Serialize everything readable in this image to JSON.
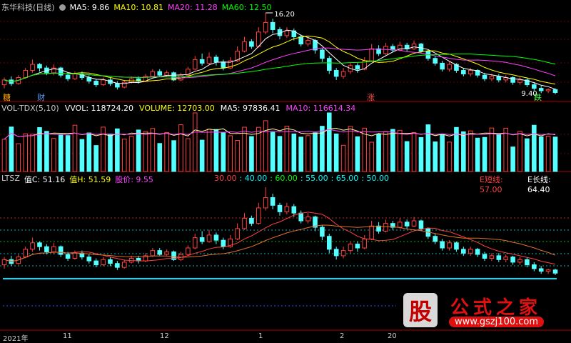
{
  "main_panel": {
    "stock_name": "东华科技(日线)",
    "ma": [
      {
        "label": "MA5: 9.86",
        "color": "#ffffff"
      },
      {
        "label": "MA10: 10.81",
        "color": "#ffff00"
      },
      {
        "label": "MA20: 11.28",
        "color": "#ff40ff"
      },
      {
        "label": "MA60: 12.50",
        "color": "#00ff00"
      }
    ],
    "annotations": {
      "high": "16.20",
      "low": "9.40"
    },
    "markers": [
      {
        "text": "糖",
        "color": "#ffa500"
      },
      {
        "text": "财",
        "color": "#5a9cff"
      },
      {
        "text": "涨",
        "color": "#ff5050"
      },
      {
        "text": "跌",
        "color": "#40ff40"
      }
    ]
  },
  "volume_panel": {
    "items": [
      {
        "label": "VOL-TDX(5,10)",
        "color": "#cccccc"
      },
      {
        "label": "VVOL: 118724.20",
        "color": "#ffffff"
      },
      {
        "label": "VOLUME: 12703.00",
        "color": "#ffff00"
      },
      {
        "label": "MA5: 97836.41",
        "color": "#ffffff"
      },
      {
        "label": "MA10: 116614.34",
        "color": "#ff40ff"
      }
    ]
  },
  "ltsz_panel": {
    "items": [
      {
        "label": "LTSZ",
        "color": "#cccccc"
      },
      {
        "label": "值C: 51.16",
        "color": "#ffffff"
      },
      {
        "label": "值H: 51.59",
        "color": "#ffff00"
      },
      {
        "label": "股价: 9.55",
        "color": "#ff40ff"
      }
    ],
    "levels": [
      {
        "label": "30.00",
        "color": "#ff4040"
      },
      {
        "label": ": 40.00",
        "color": "#00ffff"
      },
      {
        "label": ": 60.00",
        "color": "#00ff00"
      },
      {
        "label": ": 55.00",
        "color": "#00ffff"
      },
      {
        "label": ": 65.00",
        "color": "#00ffff"
      },
      {
        "label": ": 50.00",
        "color": "#00ffff"
      }
    ],
    "right_labels": [
      {
        "label": "E短线: 57.00",
        "color": "#ff4040"
      },
      {
        "label": "E长线: 64.40",
        "color": "#ffffff"
      }
    ]
  },
  "x_axis": [
    "2021年",
    "11",
    "12",
    "1",
    "2",
    "20"
  ],
  "logo": {
    "glyph": "股",
    "text": "公式之家",
    "url": "www.gszj100.com"
  },
  "chart_data": {
    "type": "candlestick",
    "panels": [
      "price",
      "volume",
      "ltsz"
    ],
    "price_range": [
      9.4,
      16.2
    ],
    "series_shape": [
      {
        "o": 10.2,
        "c": 10.6,
        "h": 10.8,
        "l": 9.9
      },
      {
        "o": 10.6,
        "c": 10.3,
        "h": 10.9,
        "l": 10.1
      },
      {
        "o": 10.3,
        "c": 10.8,
        "h": 11.0,
        "l": 10.2
      },
      {
        "o": 10.8,
        "c": 11.4,
        "h": 11.6,
        "l": 10.7
      },
      {
        "o": 11.4,
        "c": 11.9,
        "h": 12.3,
        "l": 11.2
      },
      {
        "o": 11.9,
        "c": 11.6,
        "h": 12.0,
        "l": 11.3
      },
      {
        "o": 11.6,
        "c": 11.2,
        "h": 11.8,
        "l": 11.0
      },
      {
        "o": 11.2,
        "c": 11.6,
        "h": 11.9,
        "l": 11.0
      },
      {
        "o": 11.6,
        "c": 11.0,
        "h": 11.7,
        "l": 10.8
      },
      {
        "o": 11.0,
        "c": 10.7,
        "h": 11.2,
        "l": 10.5
      },
      {
        "o": 10.7,
        "c": 11.1,
        "h": 11.3,
        "l": 10.6
      },
      {
        "o": 11.1,
        "c": 10.8,
        "h": 11.3,
        "l": 10.6
      },
      {
        "o": 10.8,
        "c": 10.5,
        "h": 11.0,
        "l": 10.3
      },
      {
        "o": 10.5,
        "c": 10.2,
        "h": 10.7,
        "l": 10.0
      },
      {
        "o": 10.2,
        "c": 10.6,
        "h": 10.8,
        "l": 10.1
      },
      {
        "o": 10.6,
        "c": 10.3,
        "h": 10.8,
        "l": 10.1
      },
      {
        "o": 10.3,
        "c": 10.0,
        "h": 10.5,
        "l": 9.8
      },
      {
        "o": 10.0,
        "c": 10.4,
        "h": 10.6,
        "l": 9.9
      },
      {
        "o": 10.4,
        "c": 10.7,
        "h": 10.9,
        "l": 10.3
      },
      {
        "o": 10.7,
        "c": 10.5,
        "h": 10.9,
        "l": 10.3
      },
      {
        "o": 10.5,
        "c": 10.9,
        "h": 11.1,
        "l": 10.4
      },
      {
        "o": 10.9,
        "c": 11.3,
        "h": 11.5,
        "l": 10.8
      },
      {
        "o": 11.3,
        "c": 11.0,
        "h": 11.5,
        "l": 10.9
      },
      {
        "o": 11.0,
        "c": 11.2,
        "h": 11.4,
        "l": 10.9
      },
      {
        "o": 11.2,
        "c": 10.6,
        "h": 11.3,
        "l": 10.5
      },
      {
        "o": 10.6,
        "c": 11.0,
        "h": 11.2,
        "l": 10.5
      },
      {
        "o": 11.0,
        "c": 11.5,
        "h": 11.7,
        "l": 10.9
      },
      {
        "o": 11.5,
        "c": 12.3,
        "h": 12.6,
        "l": 11.4
      },
      {
        "o": 12.3,
        "c": 12.0,
        "h": 12.8,
        "l": 11.8
      },
      {
        "o": 12.0,
        "c": 12.5,
        "h": 12.9,
        "l": 11.9
      },
      {
        "o": 12.5,
        "c": 12.1,
        "h": 12.7,
        "l": 11.8
      },
      {
        "o": 12.1,
        "c": 11.6,
        "h": 12.3,
        "l": 11.4
      },
      {
        "o": 11.6,
        "c": 12.2,
        "h": 12.5,
        "l": 11.5
      },
      {
        "o": 12.2,
        "c": 13.0,
        "h": 13.4,
        "l": 12.1
      },
      {
        "o": 13.0,
        "c": 13.8,
        "h": 14.2,
        "l": 12.9
      },
      {
        "o": 13.8,
        "c": 13.4,
        "h": 14.0,
        "l": 13.2
      },
      {
        "o": 13.4,
        "c": 14.6,
        "h": 15.0,
        "l": 13.3
      },
      {
        "o": 14.6,
        "c": 15.4,
        "h": 16.2,
        "l": 14.4
      },
      {
        "o": 15.4,
        "c": 14.8,
        "h": 15.7,
        "l": 14.5
      },
      {
        "o": 14.8,
        "c": 14.3,
        "h": 15.0,
        "l": 14.0
      },
      {
        "o": 14.3,
        "c": 14.7,
        "h": 15.0,
        "l": 14.1
      },
      {
        "o": 14.7,
        "c": 14.2,
        "h": 14.9,
        "l": 13.9
      },
      {
        "o": 14.2,
        "c": 13.6,
        "h": 14.4,
        "l": 13.4
      },
      {
        "o": 13.6,
        "c": 13.9,
        "h": 14.2,
        "l": 13.4
      },
      {
        "o": 13.9,
        "c": 13.1,
        "h": 14.0,
        "l": 12.8
      },
      {
        "o": 13.1,
        "c": 12.4,
        "h": 13.3,
        "l": 12.1
      },
      {
        "o": 12.4,
        "c": 11.4,
        "h": 12.6,
        "l": 11.1
      },
      {
        "o": 11.4,
        "c": 10.9,
        "h": 11.6,
        "l": 10.6
      },
      {
        "o": 10.9,
        "c": 11.3,
        "h": 11.6,
        "l": 10.7
      },
      {
        "o": 11.3,
        "c": 11.8,
        "h": 12.0,
        "l": 11.1
      },
      {
        "o": 11.8,
        "c": 11.5,
        "h": 12.0,
        "l": 11.2
      },
      {
        "o": 11.5,
        "c": 12.2,
        "h": 12.5,
        "l": 11.4
      },
      {
        "o": 12.2,
        "c": 13.2,
        "h": 13.6,
        "l": 12.1
      },
      {
        "o": 13.2,
        "c": 12.8,
        "h": 13.5,
        "l": 12.6
      },
      {
        "o": 12.8,
        "c": 13.4,
        "h": 13.7,
        "l": 12.7
      },
      {
        "o": 13.4,
        "c": 13.1,
        "h": 13.6,
        "l": 12.9
      },
      {
        "o": 13.1,
        "c": 13.5,
        "h": 13.8,
        "l": 13.0
      },
      {
        "o": 13.5,
        "c": 13.2,
        "h": 13.7,
        "l": 13.0
      },
      {
        "o": 13.2,
        "c": 13.6,
        "h": 13.9,
        "l": 13.1
      },
      {
        "o": 13.6,
        "c": 13.0,
        "h": 13.7,
        "l": 12.8
      },
      {
        "o": 13.0,
        "c": 12.4,
        "h": 13.1,
        "l": 12.2
      },
      {
        "o": 12.4,
        "c": 12.0,
        "h": 12.6,
        "l": 11.8
      },
      {
        "o": 12.0,
        "c": 11.5,
        "h": 12.2,
        "l": 11.3
      },
      {
        "o": 11.5,
        "c": 11.9,
        "h": 12.1,
        "l": 11.3
      },
      {
        "o": 11.9,
        "c": 11.4,
        "h": 12.0,
        "l": 11.2
      },
      {
        "o": 11.4,
        "c": 11.1,
        "h": 11.6,
        "l": 10.9
      },
      {
        "o": 11.1,
        "c": 11.4,
        "h": 11.6,
        "l": 10.9
      },
      {
        "o": 11.4,
        "c": 11.0,
        "h": 11.5,
        "l": 10.8
      },
      {
        "o": 11.0,
        "c": 10.7,
        "h": 11.2,
        "l": 10.5
      },
      {
        "o": 10.7,
        "c": 10.9,
        "h": 11.1,
        "l": 10.5
      },
      {
        "o": 10.9,
        "c": 10.6,
        "h": 11.1,
        "l": 10.4
      },
      {
        "o": 10.6,
        "c": 10.8,
        "h": 11.0,
        "l": 10.4
      },
      {
        "o": 10.8,
        "c": 10.4,
        "h": 10.9,
        "l": 10.2
      },
      {
        "o": 10.4,
        "c": 10.6,
        "h": 10.8,
        "l": 10.2
      },
      {
        "o": 10.6,
        "c": 10.2,
        "h": 10.8,
        "l": 10.0
      },
      {
        "o": 10.2,
        "c": 9.9,
        "h": 10.4,
        "l": 9.7
      },
      {
        "o": 9.9,
        "c": 9.7,
        "h": 10.1,
        "l": 9.5
      },
      {
        "o": 9.7,
        "c": 9.8,
        "h": 9.9,
        "l": 9.5
      },
      {
        "o": 9.8,
        "c": 9.55,
        "h": 9.9,
        "l": 9.4
      }
    ]
  }
}
